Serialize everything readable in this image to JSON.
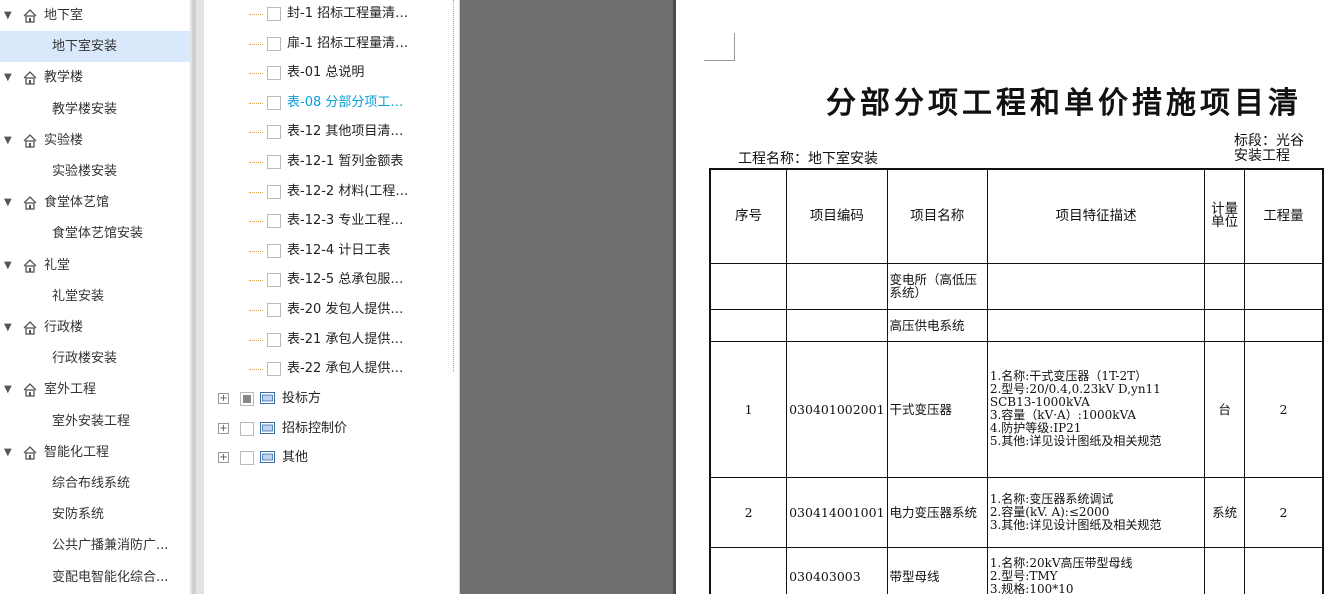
{
  "project_tree": [
    {
      "label": "地下室",
      "type": "group"
    },
    {
      "label": "地下室安装",
      "type": "child",
      "selected": true
    },
    {
      "label": "教学楼",
      "type": "group"
    },
    {
      "label": "教学楼安装",
      "type": "child"
    },
    {
      "label": "实验楼",
      "type": "group"
    },
    {
      "label": "实验楼安装",
      "type": "child"
    },
    {
      "label": "食堂体艺馆",
      "type": "group"
    },
    {
      "label": "食堂体艺馆安装",
      "type": "child"
    },
    {
      "label": "礼堂",
      "type": "group"
    },
    {
      "label": "礼堂安装",
      "type": "child"
    },
    {
      "label": "行政楼",
      "type": "group"
    },
    {
      "label": "行政楼安装",
      "type": "child"
    },
    {
      "label": "室外工程",
      "type": "group"
    },
    {
      "label": "室外安装工程",
      "type": "child"
    },
    {
      "label": "智能化工程",
      "type": "group"
    },
    {
      "label": "综合布线系统",
      "type": "child"
    },
    {
      "label": "安防系统",
      "type": "child"
    },
    {
      "label": "公共广播兼消防广...",
      "type": "child"
    },
    {
      "label": "变配电智能化综合...",
      "type": "child"
    }
  ],
  "report_tree": [
    {
      "label": "封-1 招标工程量清…"
    },
    {
      "label": "扉-1 招标工程量清…"
    },
    {
      "label": "表-01 总说明"
    },
    {
      "label": "表-08 分部分项工…",
      "active": true
    },
    {
      "label": "表-12 其他项目清…"
    },
    {
      "label": "表-12-1 暂列金额表"
    },
    {
      "label": "表-12-2 材料(工程…"
    },
    {
      "label": "表-12-3 专业工程…"
    },
    {
      "label": "表-12-4 计日工表"
    },
    {
      "label": "表-12-5 总承包服…"
    },
    {
      "label": "表-20 发包人提供…"
    },
    {
      "label": "表-21 承包人提供…"
    },
    {
      "label": "表-22 承包人提供…"
    }
  ],
  "report_groups": [
    {
      "label": "投标方",
      "partial": true
    },
    {
      "label": "招标控制价",
      "partial": false
    },
    {
      "label": "其他",
      "partial": false
    }
  ],
  "document": {
    "title": "分部分项工程和单价措施项目清",
    "project_name": "工程名称：地下室安装",
    "bid_section_line1": "标段：光谷",
    "bid_section_line2": "安装工程",
    "headers": {
      "seq": "序号",
      "code": "项目编码",
      "name": "项目名称",
      "desc": "项目特征描述",
      "unit": "计量单位",
      "qty": "工程量"
    },
    "rows": [
      {
        "seq": "",
        "code": "",
        "name": "变电所（高低压系统）",
        "desc": "",
        "unit": "",
        "qty": ""
      },
      {
        "seq": "",
        "code": "",
        "name": "高压供电系统",
        "desc": "",
        "unit": "",
        "qty": ""
      },
      {
        "seq": "1",
        "code": "030401002001",
        "name": "干式变压器",
        "desc": "1.名称:干式变压器（1T-2T）\n2.型号:20/0.4,0.23kV D,yn11 SCB13-1000kVA\n3.容量（kV·A）:1000kVA\n4.防护等级:IP21\n5.其他:详见设计图纸及相关规范",
        "unit": "台",
        "qty": "2"
      },
      {
        "seq": "2",
        "code": "030414001001",
        "name": "电力变压器系统",
        "desc": "1.名称:变压器系统调试\n2.容量(kV. A):≤2000\n3.其他:详见设计图纸及相关规范",
        "unit": "系统",
        "qty": "2"
      },
      {
        "seq": "",
        "code": "030403003",
        "name": "带型母线",
        "desc": "1.名称:20kV高压带型母线\n2.型号:TMY\n3.规格:100*10",
        "unit": "",
        "qty": ""
      }
    ]
  }
}
